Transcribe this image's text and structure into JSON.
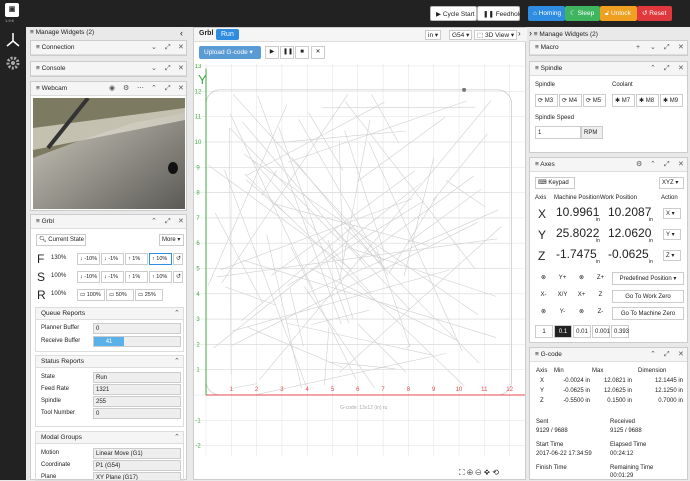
{
  "app": {
    "version": "1.9.6"
  },
  "top": {
    "cycle_start": "Cycle Start",
    "feedhold": "Feedhold",
    "homing": "Homing",
    "sleep": "Sleep",
    "unlock": "Unlock",
    "reset": "Reset"
  },
  "left": {
    "manage": "Manage Widgets (2)",
    "connection": "Connection",
    "console": "Console",
    "webcam": "Webcam",
    "grbl": "Grbl",
    "current_state": "Current State",
    "more": "More",
    "overrides": [
      {
        "axis": "F",
        "value": "130%",
        "b": [
          "-10%",
          "-1%",
          "1%",
          "10%"
        ]
      },
      {
        "axis": "S",
        "value": "100%",
        "b": [
          "-10%",
          "-1%",
          "1%",
          "10%"
        ]
      },
      {
        "axis": "R",
        "value": "100%",
        "b": [
          "100%",
          "50%",
          "25%"
        ]
      }
    ],
    "queue_title": "Queue Reports",
    "planner_label": "Planner Buffer",
    "planner_value": "0",
    "receive_label": "Receive Buffer",
    "receive_value": "41",
    "status_title": "Status Reports",
    "status": [
      {
        "k": "State",
        "v": "Run"
      },
      {
        "k": "Feed Rate",
        "v": "1321"
      },
      {
        "k": "Spindle",
        "v": "255"
      },
      {
        "k": "Tool Number",
        "v": "0"
      }
    ],
    "modal_title": "Modal Groups",
    "modal": [
      {
        "k": "Motion",
        "v": "Linear Move (G1)"
      },
      {
        "k": "Coordinate",
        "v": "P1 (G54)"
      },
      {
        "k": "Plane",
        "v": "XY Plane (G17)"
      }
    ]
  },
  "center": {
    "grbl": "Grbl",
    "run": "Run",
    "upload": "Upload G-code",
    "units": "in",
    "wcs": "G54",
    "view": "3D View",
    "dims": "G-code: 13x12 (in) ru",
    "x_ticks": [
      "1",
      "2",
      "3",
      "4",
      "5",
      "6",
      "7",
      "8",
      "9",
      "10",
      "11",
      "12"
    ],
    "y_ticks": [
      "1",
      "2",
      "3",
      "4",
      "5",
      "6",
      "7",
      "8",
      "9",
      "10",
      "11",
      "12",
      "13"
    ],
    "neg": [
      "-1",
      "-2"
    ],
    "x_label": "X",
    "y_label": "Y"
  },
  "right": {
    "manage": "Manage Widgets (2)",
    "macro": "Macro",
    "spindle_title": "Spindle",
    "spindle": "Spindle",
    "coolant": "Coolant",
    "spindle_btns": [
      "M3",
      "M4",
      "M5"
    ],
    "coolant_btns": [
      "M7",
      "M8",
      "M9"
    ],
    "speed_label": "Spindle Speed",
    "speed_value": "1",
    "rpm": "RPM",
    "axes_title": "Axes",
    "keypad": "Keypad",
    "xyz": "XYZ",
    "axes_headers": [
      "Axis",
      "Machine Position",
      "Work Position",
      "Action"
    ],
    "axes": [
      {
        "a": "X",
        "m": "10.9961",
        "w": "10.2087",
        "act": "X"
      },
      {
        "a": "Y",
        "m": "25.8022",
        "w": "12.0620",
        "act": "Y"
      },
      {
        "a": "Z",
        "m": "-1.7475",
        "w": "-0.0625",
        "act": "Z"
      }
    ],
    "unit": "in",
    "jog": [
      [
        "Y+",
        "Z+"
      ],
      [
        "X-",
        "X/Y",
        "X+",
        "Z"
      ],
      [
        "Y-",
        "Z-"
      ]
    ],
    "predef": "Predefined Position",
    "goto_work": "Go To Work Zero",
    "goto_machine": "Go To Machine Zero",
    "steps": [
      "1",
      "0.1",
      "0.01",
      "0.001",
      "0.393"
    ],
    "gcode_title": "G-code",
    "g_headers": [
      "Axis",
      "Min",
      "Max",
      "Dimension"
    ],
    "g_rows": [
      {
        "a": "X",
        "min": "-0.0024 in",
        "max": "12.0821 in",
        "dim": "12.1445 in"
      },
      {
        "a": "Y",
        "min": "-0.0625 in",
        "max": "12.0625 in",
        "dim": "12.1250 in"
      },
      {
        "a": "Z",
        "min": "-0.5500 in",
        "max": "0.1500 in",
        "dim": "0.7000 in"
      }
    ],
    "sent_label": "Sent",
    "sent": "9129 / 9688",
    "recv_label": "Received",
    "recv": "9125 / 9688",
    "start_label": "Start Time",
    "start": "2017-06-22 17:34:59",
    "elapsed_label": "Elapsed Time",
    "elapsed": "00:24:12",
    "finish_label": "Finish Time",
    "finish": "",
    "remaining_label": "Remaining Time",
    "remaining": "00:01:29"
  }
}
